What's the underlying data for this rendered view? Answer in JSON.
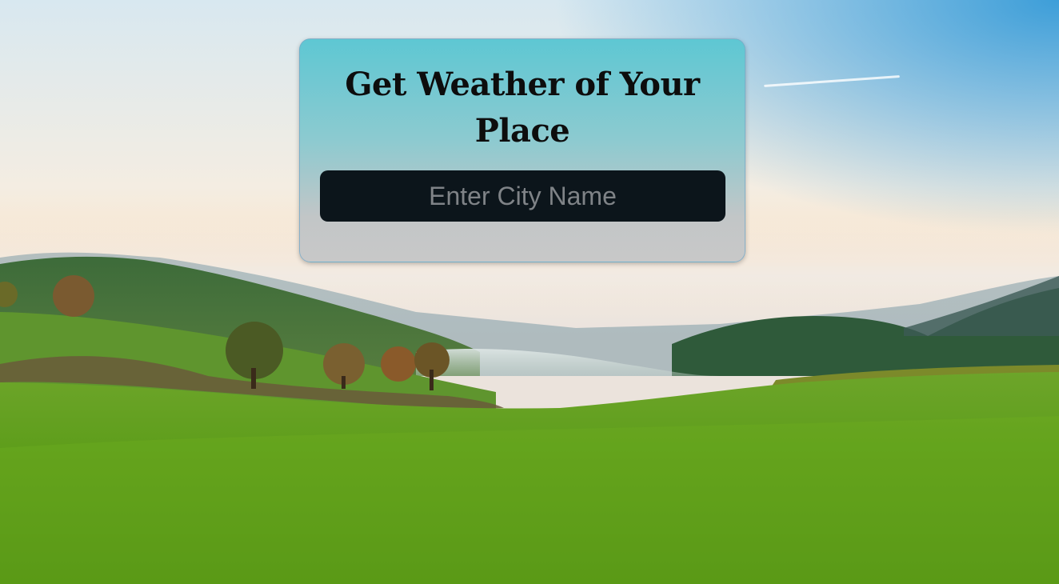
{
  "page": {
    "title": "Get Weather of Your Place"
  },
  "search": {
    "placeholder": "Enter City Name",
    "value": ""
  },
  "background": {
    "icon": "landscape-photo",
    "accent_color": "#5ec7d3",
    "input_color": "#0c151b"
  }
}
